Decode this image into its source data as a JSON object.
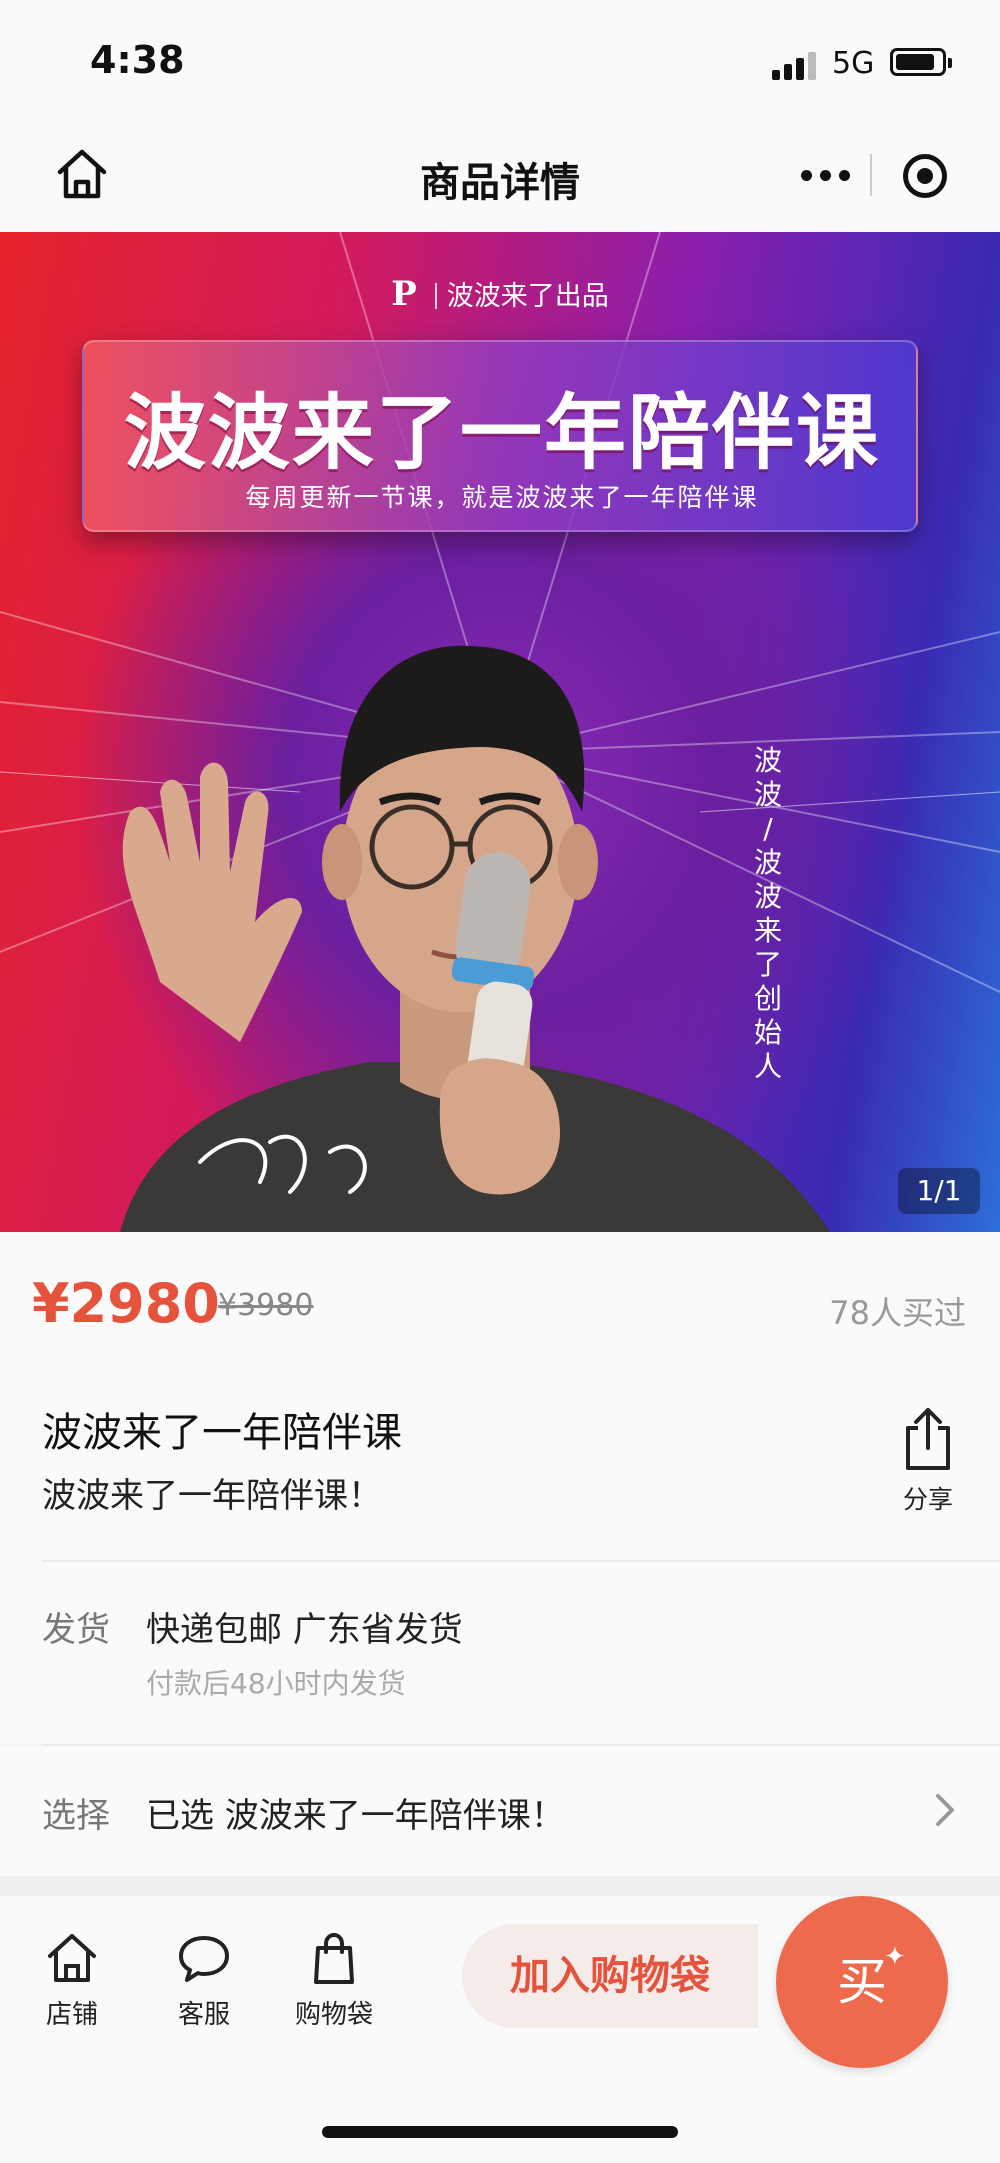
{
  "status_bar": {
    "time": "4:38",
    "network": "5G"
  },
  "nav": {
    "title": "商品详情",
    "home_icon": "home-icon",
    "more_icon": "more-dots-icon",
    "close_icon": "target-icon"
  },
  "banner": {
    "brand_logo": "P",
    "brand_text": "波波来了出品",
    "title": "波波来了一年陪伴课",
    "subtitle": "每周更新一节课，就是波波来了一年陪伴课",
    "vertical_caption": [
      "波",
      "波",
      "/",
      "波",
      "波",
      "来",
      "了",
      "创",
      "始",
      "人"
    ],
    "page_indicator": "1/1",
    "colors": {
      "left": "#e4232a",
      "mid": "#8a1fae",
      "right": "#2c6fd8"
    }
  },
  "price": {
    "current": "¥2980",
    "original": "¥3980",
    "sold": "78人买过",
    "accent": "#e5533c"
  },
  "product": {
    "name": "波波来了一年陪伴课",
    "description": "波波来了一年陪伴课！",
    "share_label": "分享"
  },
  "shipping": {
    "key": "发货",
    "value": "快递包邮  广东省发货",
    "note": "付款后48小时内发货"
  },
  "option": {
    "key": "选择",
    "value": "已选  波波来了一年陪伴课！"
  },
  "bottom_bar": {
    "tabs": [
      {
        "label": "店铺",
        "icon": "store-icon"
      },
      {
        "label": "客服",
        "icon": "chat-icon"
      },
      {
        "label": "购物袋",
        "icon": "bag-icon"
      }
    ],
    "add_to_cart": "加入购物袋",
    "buy": "买"
  }
}
